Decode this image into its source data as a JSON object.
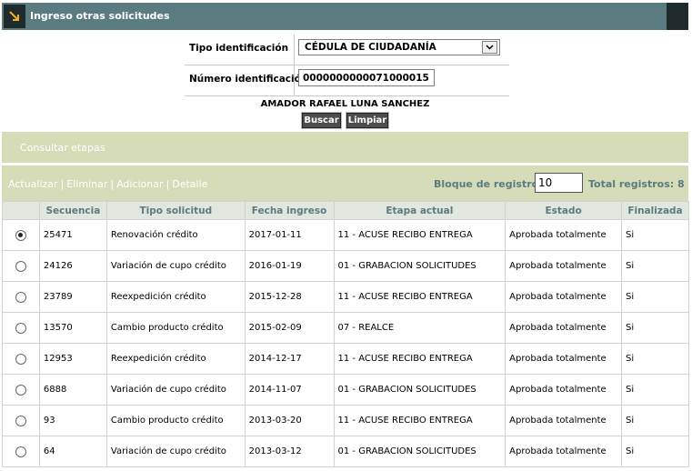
{
  "header": {
    "title": "Ingreso otras solicitudes",
    "icon": "arrow-down-right-icon"
  },
  "form": {
    "tipo_label": "Tipo identificación",
    "tipo_value": "CÉDULA DE CIUDADANÍA",
    "numero_label": "Número identificación",
    "numero_value": "0000000000071000015",
    "person_name": "AMADOR RAFAEL LUNA SANCHEZ",
    "buscar_label": "Buscar",
    "limpiar_label": "Limpiar"
  },
  "section": {
    "title": "Consultar etapas"
  },
  "toolbar": {
    "actualizar": "Actualizar",
    "eliminar": "Eliminar",
    "adicionar": "Adicionar",
    "detalle": "Detalle",
    "bloque_label": "Bloque de registros:",
    "bloque_value": "10",
    "total_label": "Total registros: 8"
  },
  "table": {
    "headers": [
      "",
      "Secuencia",
      "Tipo solicitud",
      "Fecha ingreso",
      "Etapa actual",
      "Estado",
      "Finalizada"
    ],
    "rows": [
      {
        "selected": true,
        "secuencia": "25471",
        "tipo": "Renovación crédito",
        "fecha": "2017-01-11",
        "etapa": "11 - ACUSE RECIBO ENTREGA",
        "estado": "Aprobada totalmente",
        "finalizada": "Si"
      },
      {
        "selected": false,
        "secuencia": "24126",
        "tipo": "Variación de cupo crédito",
        "fecha": "2016-01-19",
        "etapa": "01 - GRABACION SOLICITUDES",
        "estado": "Aprobada totalmente",
        "finalizada": "Si"
      },
      {
        "selected": false,
        "secuencia": "23789",
        "tipo": "Reexpedición crédito",
        "fecha": "2015-12-28",
        "etapa": "11 - ACUSE RECIBO ENTREGA",
        "estado": "Aprobada totalmente",
        "finalizada": "Si"
      },
      {
        "selected": false,
        "secuencia": "13570",
        "tipo": "Cambio producto crédito",
        "fecha": "2015-02-09",
        "etapa": "07 - REALCE",
        "estado": "Aprobada totalmente",
        "finalizada": "Si"
      },
      {
        "selected": false,
        "secuencia": "12953",
        "tipo": "Reexpedición crédito",
        "fecha": "2014-12-17",
        "etapa": "11 - ACUSE RECIBO ENTREGA",
        "estado": "Aprobada totalmente",
        "finalizada": "Si"
      },
      {
        "selected": false,
        "secuencia": "6888",
        "tipo": "Variación de cupo crédito",
        "fecha": "2014-11-07",
        "etapa": "01 - GRABACION SOLICITUDES",
        "estado": "Aprobada totalmente",
        "finalizada": "Si"
      },
      {
        "selected": false,
        "secuencia": "93",
        "tipo": "Cambio producto crédito",
        "fecha": "2013-03-20",
        "etapa": "11 - ACUSE RECIBO ENTREGA",
        "estado": "Aprobada totalmente",
        "finalizada": "Si"
      },
      {
        "selected": false,
        "secuencia": "64",
        "tipo": "Variación de cupo crédito",
        "fecha": "2013-03-12",
        "etapa": "01 - GRABACION SOLICITUDES",
        "estado": "Aprobada totalmente",
        "finalizada": "Si"
      }
    ]
  }
}
